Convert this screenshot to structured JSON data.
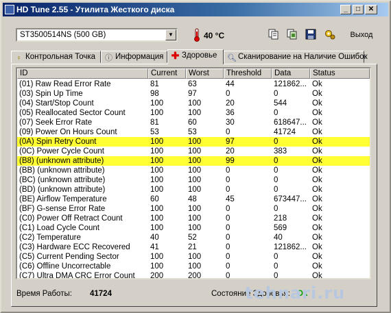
{
  "window": {
    "title": "HD Tune 2.55 - Утилита Жесткого диска"
  },
  "toolbar": {
    "drive": "ST3500514NS (500 GB)",
    "temperature": "40 °C",
    "exit_label": "Выход"
  },
  "tabs": [
    {
      "label": "Контрольная Точка",
      "icon": "benchmark-icon"
    },
    {
      "label": "Информация",
      "icon": "info-icon"
    },
    {
      "label": "Здоровье",
      "icon": "health-icon"
    },
    {
      "label": "Сканирование на Наличие Ошибок",
      "icon": "scan-icon"
    }
  ],
  "table": {
    "columns": [
      "ID",
      "Current",
      "Worst",
      "Threshold",
      "Data",
      "Status"
    ],
    "rows": [
      {
        "id": "(01) Raw Read Error Rate",
        "current": "81",
        "worst": "63",
        "threshold": "44",
        "data": "121862...",
        "status": "Ok"
      },
      {
        "id": "(03) Spin Up Time",
        "current": "98",
        "worst": "97",
        "threshold": "0",
        "data": "0",
        "status": "Ok"
      },
      {
        "id": "(04) Start/Stop Count",
        "current": "100",
        "worst": "100",
        "threshold": "20",
        "data": "544",
        "status": "Ok"
      },
      {
        "id": "(05) Reallocated Sector Count",
        "current": "100",
        "worst": "100",
        "threshold": "36",
        "data": "0",
        "status": "Ok"
      },
      {
        "id": "(07) Seek Error Rate",
        "current": "81",
        "worst": "60",
        "threshold": "30",
        "data": "618647...",
        "status": "Ok"
      },
      {
        "id": "(09) Power On Hours Count",
        "current": "53",
        "worst": "53",
        "threshold": "0",
        "data": "41724",
        "status": "Ok"
      },
      {
        "id": "(0A) Spin Retry Count",
        "current": "100",
        "worst": "100",
        "threshold": "97",
        "data": "0",
        "status": "Ok"
      },
      {
        "id": "(0C) Power Cycle Count",
        "current": "100",
        "worst": "100",
        "threshold": "20",
        "data": "383",
        "status": "Ok"
      },
      {
        "id": "(B8) (unknown attribute)",
        "current": "100",
        "worst": "100",
        "threshold": "99",
        "data": "0",
        "status": "Ok"
      },
      {
        "id": "(BB) (unknown attribute)",
        "current": "100",
        "worst": "100",
        "threshold": "0",
        "data": "0",
        "status": "Ok"
      },
      {
        "id": "(BC) (unknown attribute)",
        "current": "100",
        "worst": "100",
        "threshold": "0",
        "data": "0",
        "status": "Ok"
      },
      {
        "id": "(BD) (unknown attribute)",
        "current": "100",
        "worst": "100",
        "threshold": "0",
        "data": "0",
        "status": "Ok"
      },
      {
        "id": "(BE) Airflow Temperature",
        "current": "60",
        "worst": "48",
        "threshold": "45",
        "data": "673447...",
        "status": "Ok"
      },
      {
        "id": "(BF) G-sense Error Rate",
        "current": "100",
        "worst": "100",
        "threshold": "0",
        "data": "0",
        "status": "Ok"
      },
      {
        "id": "(C0) Power Off Retract Count",
        "current": "100",
        "worst": "100",
        "threshold": "0",
        "data": "218",
        "status": "Ok"
      },
      {
        "id": "(C1) Load Cycle Count",
        "current": "100",
        "worst": "100",
        "threshold": "0",
        "data": "569",
        "status": "Ok"
      },
      {
        "id": "(C2) Temperature",
        "current": "40",
        "worst": "52",
        "threshold": "0",
        "data": "40",
        "status": "Ok"
      },
      {
        "id": "(C3) Hardware ECC Recovered",
        "current": "41",
        "worst": "21",
        "threshold": "0",
        "data": "121862...",
        "status": "Ok"
      },
      {
        "id": "(C5) Current Pending Sector",
        "current": "100",
        "worst": "100",
        "threshold": "0",
        "data": "0",
        "status": "Ok"
      },
      {
        "id": "(C6) Offline Uncorrectable",
        "current": "100",
        "worst": "100",
        "threshold": "0",
        "data": "0",
        "status": "Ok"
      },
      {
        "id": "(C7) Ultra DMA CRC Error Count",
        "current": "200",
        "worst": "200",
        "threshold": "0",
        "data": "0",
        "status": "Ok"
      }
    ],
    "highlighted_rows": [
      6,
      8
    ],
    "highlight_color": "#ffff33"
  },
  "status_bar": {
    "uptime_label": "Время Работы:",
    "uptime_value": "41724",
    "health_label": "Состояние Здоровья:",
    "health_value": "Ok",
    "health_color": "#00a000"
  },
  "watermark": "tehnari.ru",
  "colors": {
    "titlebar": "#0a246a",
    "window_bg": "#d4d0c8"
  }
}
